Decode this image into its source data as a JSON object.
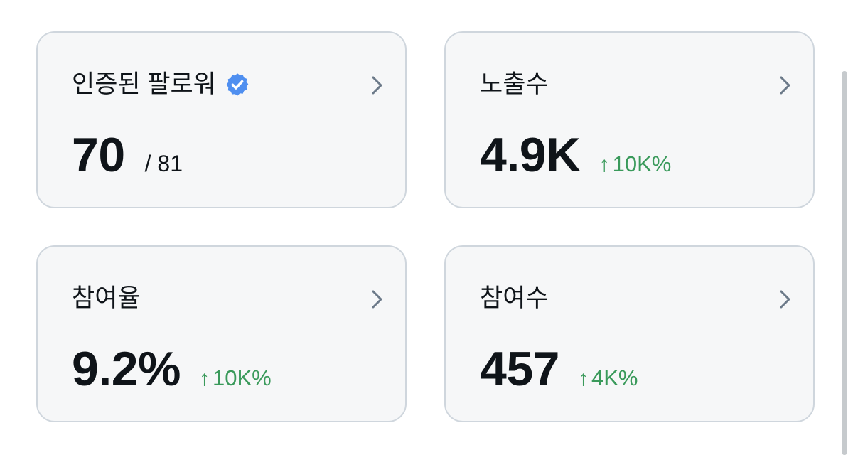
{
  "cards": [
    {
      "title": "인증된 팔로워",
      "title_icon": "verified-badge-icon",
      "value": "70",
      "secondary": "/ 81",
      "chevron_icon": "chevron-right-icon"
    },
    {
      "title": "노출수",
      "value": "4.9K",
      "trend": {
        "arrow": "↑",
        "text": "10K%"
      },
      "chevron_icon": "chevron-right-icon"
    },
    {
      "title": "참여율",
      "value": "9.2%",
      "trend": {
        "arrow": "↑",
        "text": "10K%"
      },
      "chevron_icon": "chevron-right-icon"
    },
    {
      "title": "참여수",
      "value": "457",
      "trend": {
        "arrow": "↑",
        "text": "4K%"
      },
      "chevron_icon": "chevron-right-icon"
    }
  ],
  "colors": {
    "card_background": "#f6f7f8",
    "card_border": "#cfd6dd",
    "text_primary": "#0f1419",
    "trend_positive": "#3a9a5b",
    "verified_badge": "#4f8ff0",
    "chevron": "#6c7a89"
  }
}
